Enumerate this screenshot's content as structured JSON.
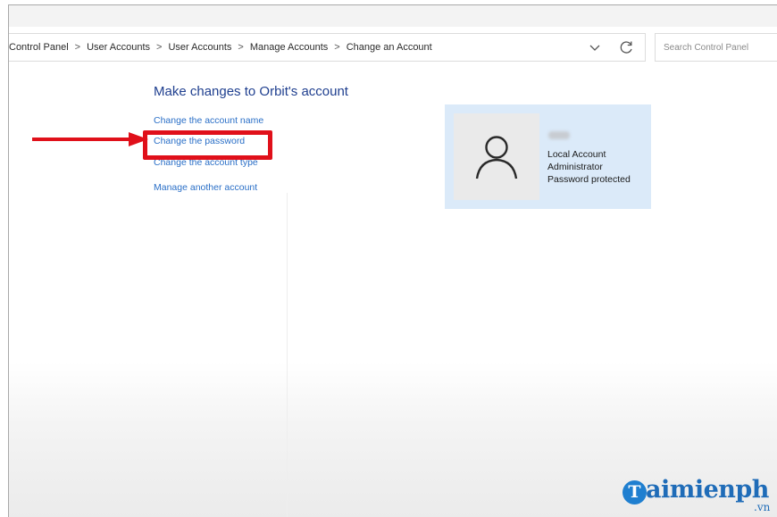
{
  "breadcrumb": {
    "items": [
      "Control Panel",
      "User Accounts",
      "User Accounts",
      "Manage Accounts",
      "Change an Account"
    ],
    "separator": ">"
  },
  "search": {
    "placeholder": "Search Control Panel"
  },
  "main": {
    "heading": "Make changes to Orbit's account",
    "tasks": {
      "change_name": "Change the account name",
      "change_password": "Change the password",
      "change_type": "Change the account type",
      "manage_another": "Manage another account"
    }
  },
  "account": {
    "lines": [
      "Local Account",
      "Administrator",
      "Password protected"
    ],
    "icon": "user-icon"
  },
  "annotation": {
    "arrow_color": "#e0101a",
    "highlight_color": "#e0101a"
  },
  "watermark": {
    "main": "aimienph",
    "suffix": ".vn",
    "logo_letter": "T"
  },
  "colors": {
    "link": "#2a6fc7",
    "heading": "#1f3f8f",
    "card": "#dbeaf9"
  }
}
